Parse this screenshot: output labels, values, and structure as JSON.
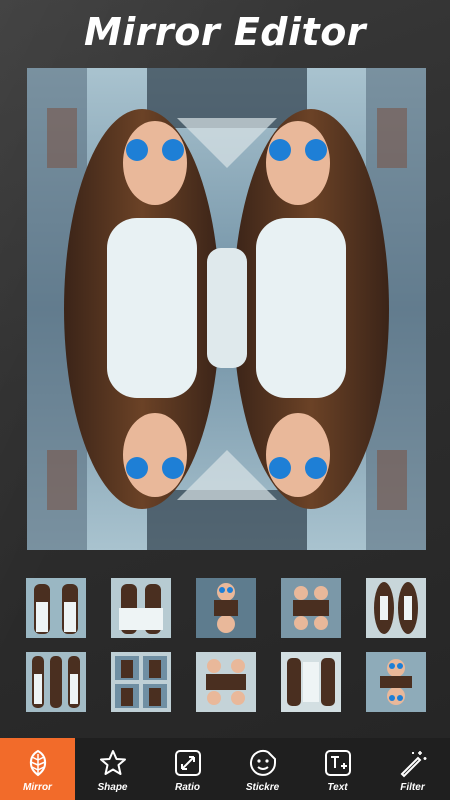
{
  "header": {
    "title": "Mirror Editor"
  },
  "preview": {
    "description_icon": "mirrored-photo"
  },
  "thumbnails": [
    {
      "icon": "mirror-layout-1"
    },
    {
      "icon": "mirror-layout-2"
    },
    {
      "icon": "mirror-layout-3"
    },
    {
      "icon": "mirror-layout-4"
    },
    {
      "icon": "mirror-layout-5"
    },
    {
      "icon": "mirror-layout-6"
    },
    {
      "icon": "mirror-layout-7"
    },
    {
      "icon": "mirror-layout-8"
    },
    {
      "icon": "mirror-layout-9"
    },
    {
      "icon": "mirror-layout-10"
    }
  ],
  "toolbar": {
    "items": [
      {
        "label": "Mirror",
        "icon": "leaf-icon",
        "active": true
      },
      {
        "label": "Shape",
        "icon": "star-icon",
        "active": false
      },
      {
        "label": "Ratio",
        "icon": "ratio-icon",
        "active": false
      },
      {
        "label": "Stickre",
        "icon": "smiley-icon",
        "active": false
      },
      {
        "label": "Text",
        "icon": "text-icon",
        "active": false
      },
      {
        "label": "Filter",
        "icon": "magic-wand-icon",
        "active": false
      }
    ]
  },
  "colors": {
    "accent": "#f26b2a",
    "bar": "#1f1f1f",
    "background": "#2d2d2d"
  }
}
